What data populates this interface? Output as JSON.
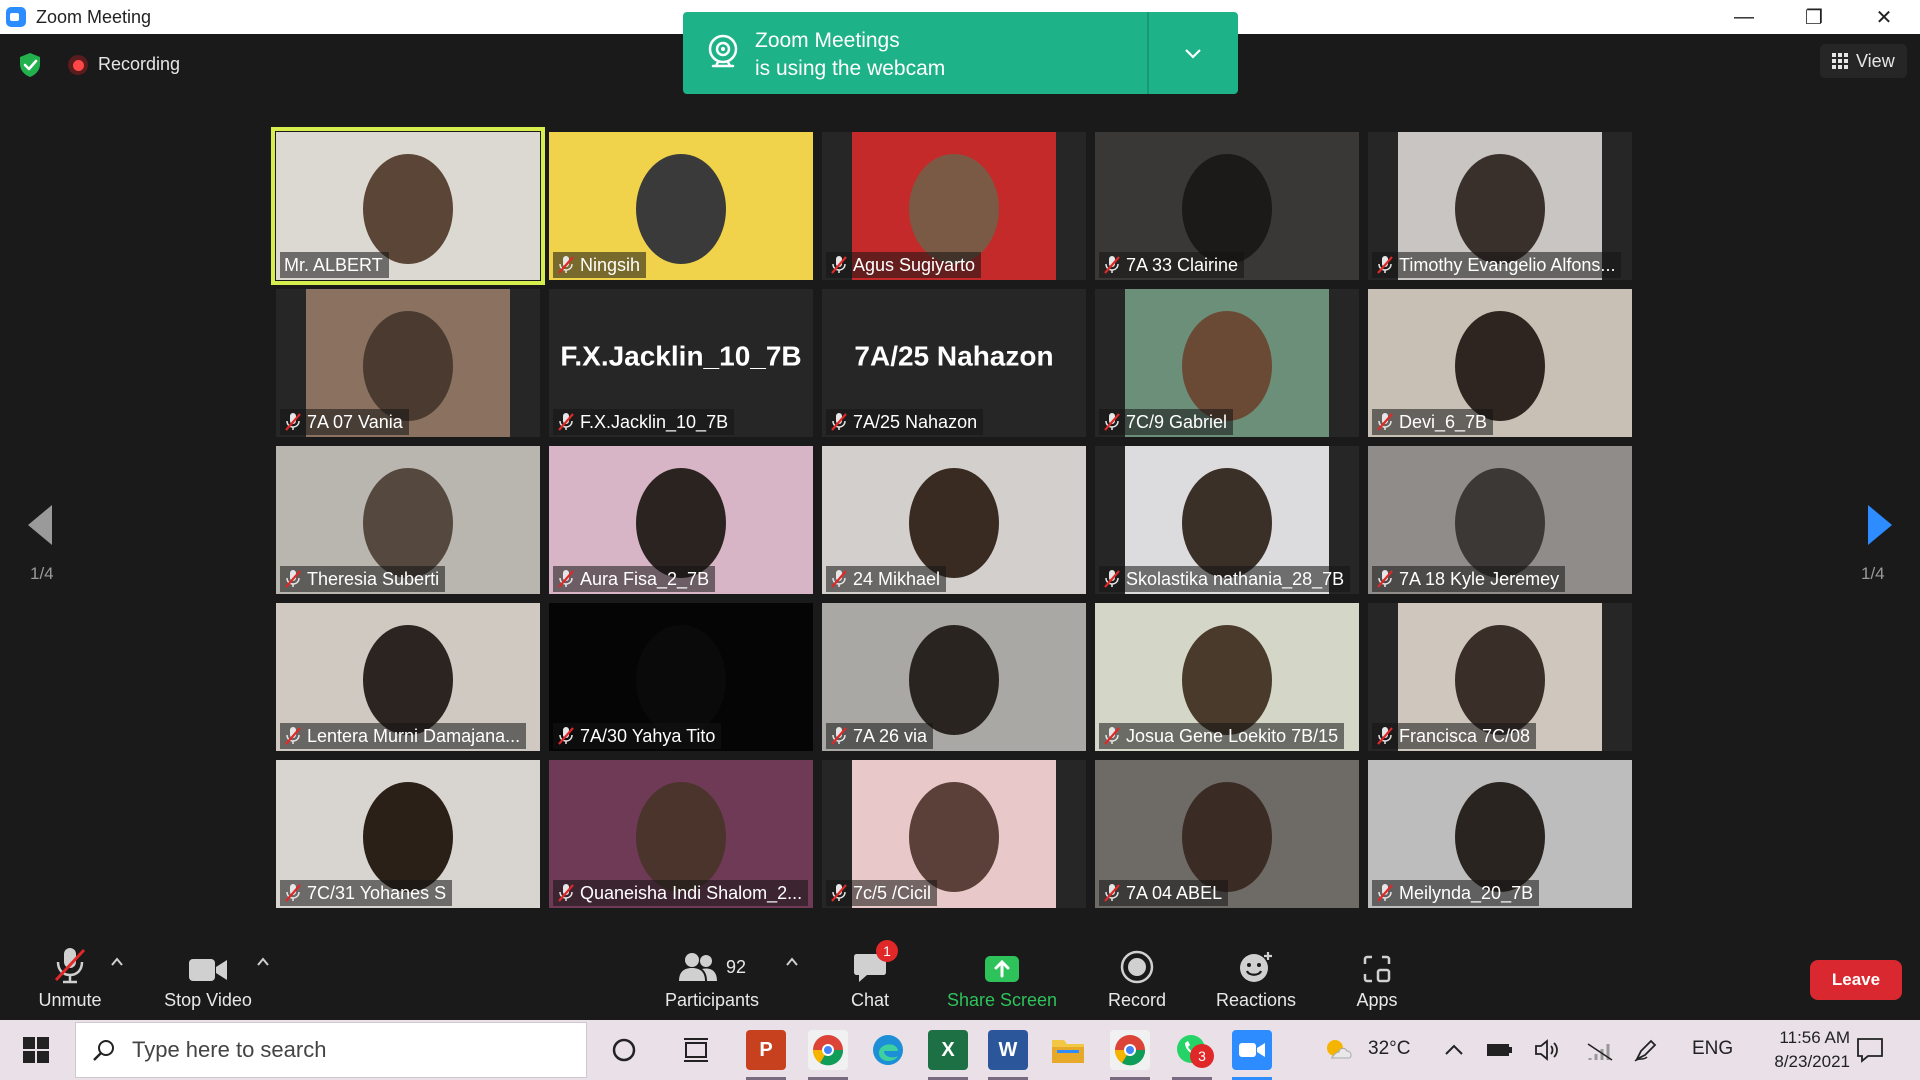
{
  "window": {
    "title": "Zoom Meeting",
    "minimize_glyph": "—",
    "restore_glyph": "❐",
    "close_glyph": "✕"
  },
  "status": {
    "recording_label": "Recording"
  },
  "notification": {
    "line1": "Zoom Meetings",
    "line2": "is using the webcam"
  },
  "view_button": {
    "label": "View"
  },
  "pagination": {
    "left": "1/4",
    "right": "1/4"
  },
  "participants": [
    {
      "name": "Mr. ALBERT",
      "muted": false,
      "active": true,
      "video": "full",
      "bg": "#dcd8d2",
      "figure": "#5a4536"
    },
    {
      "name": "Ningsih",
      "muted": true,
      "video": "full",
      "bg": "#f0d34a",
      "figure": "#3a3a3a"
    },
    {
      "name": "Agus Sugiyarto",
      "muted": true,
      "video": "inset",
      "bg": "#c52a2a",
      "figure": "#7a5a45"
    },
    {
      "name": "7A 33 Clairine",
      "muted": true,
      "video": "full",
      "bg": "#3a3836",
      "figure": "#1c1a18"
    },
    {
      "name": "Timothy Evangelio Alfons...",
      "muted": true,
      "video": "inset",
      "bg": "#c9c5c2",
      "figure": "#3a302b"
    },
    {
      "name": "7A 07 Vania",
      "muted": true,
      "video": "inset",
      "bg": "#8a7160",
      "figure": "#4a3a30"
    },
    {
      "name": "F.X.Jacklin_10_7B",
      "muted": true,
      "video": "none",
      "big_name": "F.X.Jacklin_10_7B"
    },
    {
      "name": "7A/25 Nahazon",
      "muted": true,
      "video": "none",
      "big_name": "7A/25 Nahazon"
    },
    {
      "name": "7C/9 Gabriel",
      "muted": true,
      "video": "inset",
      "bg": "#6c8f7a",
      "figure": "#6b4a35"
    },
    {
      "name": "Devi_6_7B",
      "muted": true,
      "video": "full",
      "bg": "#c8c0b5",
      "figure": "#2e2520"
    },
    {
      "name": "Theresia Suberti",
      "muted": true,
      "video": "full",
      "bg": "#b9b6b0",
      "figure": "#55483f"
    },
    {
      "name": "Aura Fisa_2_7B",
      "muted": true,
      "video": "full",
      "bg": "#d7b4c6",
      "figure": "#2b2320"
    },
    {
      "name": "24 Mikhael",
      "muted": true,
      "video": "full",
      "bg": "#d2cfcc",
      "figure": "#3a2b22"
    },
    {
      "name": "Skolastika nathania_28_7B",
      "muted": true,
      "video": "inset",
      "bg": "#dcdcde",
      "figure": "#3b3028"
    },
    {
      "name": "7A 18 Kyle Jeremey",
      "muted": true,
      "video": "full",
      "bg": "#8f8c8a",
      "figure": "#3c3836"
    },
    {
      "name": "Lentera Murni Damajana...",
      "muted": true,
      "video": "full",
      "bg": "#cfc9c2",
      "figure": "#2c2420"
    },
    {
      "name": "7A/30 Yahya Tito",
      "muted": true,
      "video": "full",
      "bg": "#050505",
      "figure": "#0a0a0a"
    },
    {
      "name": "7A 26 via",
      "muted": true,
      "video": "full",
      "bg": "#a9a8a4",
      "figure": "#2a2420"
    },
    {
      "name": "Josua Gene Loekito 7B/15",
      "muted": true,
      "video": "full",
      "bg": "#d4d7c8",
      "figure": "#4a3a2c"
    },
    {
      "name": "Francisca 7C/08",
      "muted": true,
      "video": "inset",
      "bg": "#cfc7bd",
      "figure": "#3a2e28"
    },
    {
      "name": "7C/31 Yohanes S",
      "muted": true,
      "video": "full",
      "bg": "#d8d4d0",
      "figure": "#2a2018"
    },
    {
      "name": "Quaneisha Indi Shalom_2...",
      "muted": true,
      "video": "full",
      "bg": "#6e3a55",
      "figure": "#4a342c"
    },
    {
      "name": "7c/5 /Cicil",
      "muted": true,
      "video": "inset",
      "bg": "#e8c8c8",
      "figure": "#5a4038"
    },
    {
      "name": "7A 04 ABEL",
      "muted": true,
      "video": "full",
      "bg": "#6e6a66",
      "figure": "#3a2c24"
    },
    {
      "name": "Meilynda_20_7B",
      "muted": true,
      "video": "full",
      "bg": "#bdbdbd",
      "figure": "#2a2420"
    }
  ],
  "toolbar": {
    "unmute": "Unmute",
    "stop_video": "Stop Video",
    "participants": "Participants",
    "participants_count": "92",
    "chat": "Chat",
    "chat_badge": "1",
    "share_screen": "Share Screen",
    "record": "Record",
    "reactions": "Reactions",
    "apps": "Apps",
    "leave": "Leave"
  },
  "taskbar": {
    "search_placeholder": "Type here to search",
    "whatsapp_badge": "3",
    "temperature": "32°C",
    "language": "ENG",
    "time": "11:56 AM",
    "date": "8/23/2021"
  },
  "colors": {
    "accent_green": "#1db287",
    "active_speaker": "#d6ee4e",
    "leave_red": "#d9282f",
    "share_green": "#2ec25a",
    "zoom_blue": "#2d8cff"
  }
}
